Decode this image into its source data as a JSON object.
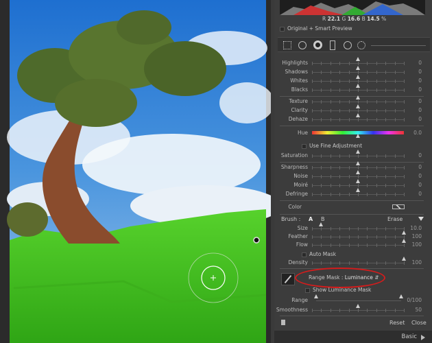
{
  "histogram": {
    "r_label": "R",
    "r_value": "22.1",
    "g_label": "G",
    "g_value": "16.6",
    "b_label": "B",
    "b_value": "14.5",
    "unit": "%"
  },
  "preview_label": "Original + Smart Preview",
  "basic_sliders": [
    {
      "label": "Highlights",
      "value": "0",
      "level": 0.5
    },
    {
      "label": "Shadows",
      "value": "0",
      "level": 0.5
    },
    {
      "label": "Whites",
      "value": "0",
      "level": 0.5
    },
    {
      "label": "Blacks",
      "value": "0",
      "level": 0.5
    }
  ],
  "presence_sliders": [
    {
      "label": "Texture",
      "value": "0",
      "level": 0.5
    },
    {
      "label": "Clarity",
      "value": "0",
      "level": 0.5
    },
    {
      "label": "Dehaze",
      "value": "0",
      "level": 0.5
    }
  ],
  "hue": {
    "label": "Hue",
    "value": "0.0",
    "level": 0.5
  },
  "fine_adjust_label": "Use Fine Adjustment",
  "saturation": {
    "label": "Saturation",
    "value": "0",
    "level": 0.5
  },
  "detail_sliders": [
    {
      "label": "Sharpness",
      "value": "0",
      "level": 0.5
    },
    {
      "label": "Noise",
      "value": "0",
      "level": 0.5
    },
    {
      "label": "Moiré",
      "value": "0",
      "level": 0.5
    },
    {
      "label": "Defringe",
      "value": "0",
      "level": 0.5
    }
  ],
  "color_label": "Color",
  "brush": {
    "label": "Brush :",
    "a": "A",
    "b": "B",
    "erase": "Erase"
  },
  "brush_sliders": [
    {
      "label": "Size",
      "value": "10.0",
      "level": 0.1
    },
    {
      "label": "Feather",
      "value": "100",
      "level": 1
    },
    {
      "label": "Flow",
      "value": "100",
      "level": 1
    }
  ],
  "auto_mask_label": "Auto Mask",
  "density": {
    "label": "Density",
    "value": "100",
    "level": 1
  },
  "range_mask": {
    "label": "Range Mask :",
    "value": "Luminance"
  },
  "show_mask_label": "Show Luminance Mask",
  "range": {
    "label": "Range",
    "value": "0/100"
  },
  "smoothness": {
    "label": "Smoothness",
    "value": "50",
    "level": 0.5
  },
  "reset_label": "Reset",
  "close_label": "Close",
  "basic_label": "Basic"
}
